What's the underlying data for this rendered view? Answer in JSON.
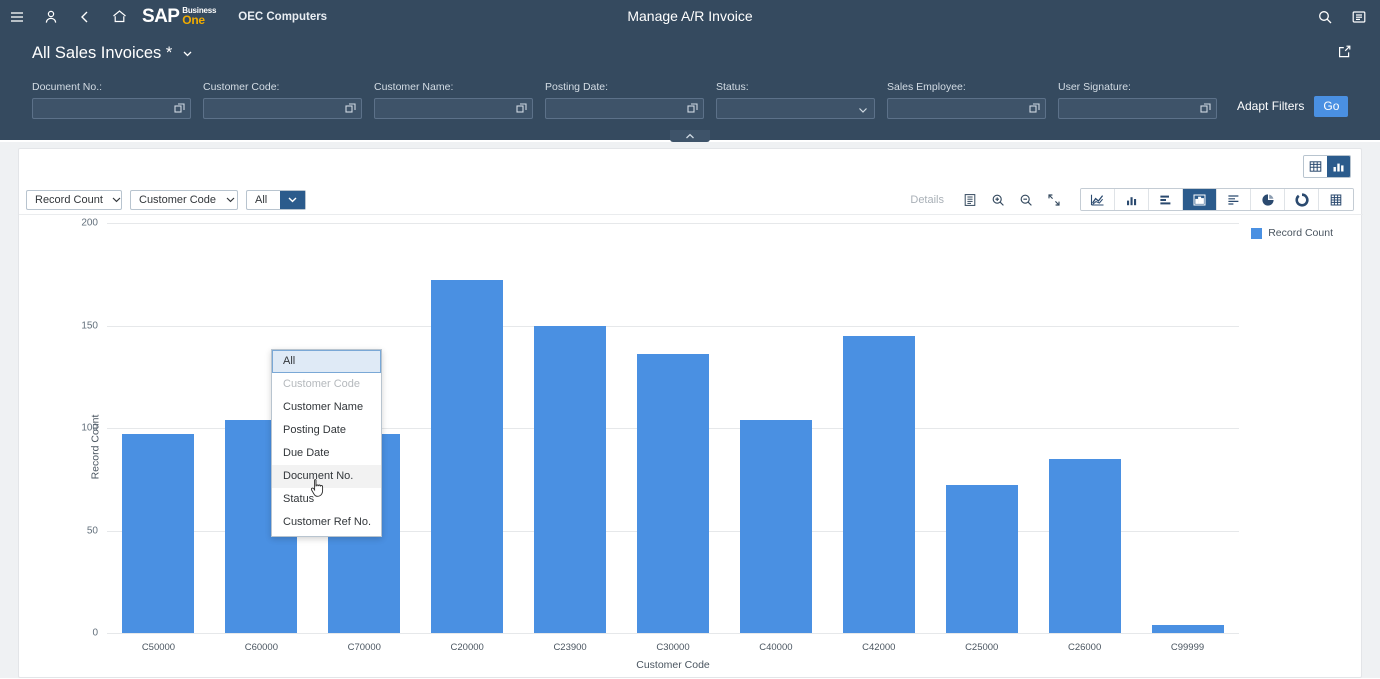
{
  "shell": {
    "title": "Manage A/R Invoice",
    "tenant": "OEC Computers",
    "logo_main": "SAP",
    "logo_sub_top": "Business",
    "logo_sub_bottom": "One",
    "icons": {
      "menu": "menu-icon",
      "user": "user-icon",
      "back": "back-icon",
      "home": "home-icon",
      "search": "search-icon",
      "overflow": "overflow-menu-icon"
    }
  },
  "variant": {
    "title": "All Sales Invoices *",
    "share_icon": "share-icon"
  },
  "filters": {
    "fields": [
      {
        "label": "Document No.:",
        "value": "",
        "type": "valuehelp"
      },
      {
        "label": "Customer Code:",
        "value": "",
        "type": "valuehelp"
      },
      {
        "label": "Customer Name:",
        "value": "",
        "type": "valuehelp"
      },
      {
        "label": "Posting Date:",
        "value": "",
        "type": "valuehelp"
      },
      {
        "label": "Status:",
        "value": "",
        "type": "select"
      },
      {
        "label": "Sales Employee:",
        "value": "",
        "type": "valuehelp"
      },
      {
        "label": "User Signature:",
        "value": "",
        "type": "valuehelp"
      }
    ],
    "adapt_filters_label": "Adapt Filters",
    "go_label": "Go"
  },
  "view_toggle": {
    "table_label": "table-view",
    "chart_label": "chart-view",
    "active": "chart"
  },
  "chart_toolbar": {
    "measure_dropdown": {
      "value": "Record Count"
    },
    "dimension_dropdown": {
      "value": "Customer Code"
    },
    "drill_dropdown": {
      "value": "All",
      "open": true
    },
    "details_label": "Details",
    "icons": [
      "legend-list-icon",
      "zoom-in-icon",
      "zoom-out-icon",
      "fullscreen-icon"
    ],
    "chart_types": [
      {
        "name": "line-chart-icon",
        "active": false
      },
      {
        "name": "column-chart-icon",
        "active": false
      },
      {
        "name": "bar-chart-icon",
        "active": false
      },
      {
        "name": "combined-column-chart-icon",
        "active": true
      },
      {
        "name": "stacked-bar-chart-icon",
        "active": false
      },
      {
        "name": "pie-chart-icon",
        "active": false
      },
      {
        "name": "donut-chart-icon",
        "active": false
      },
      {
        "name": "heatmap-chart-icon",
        "active": false
      }
    ]
  },
  "dropdown_menu": {
    "items": [
      {
        "label": "All",
        "state": "selected"
      },
      {
        "label": "Customer Code",
        "state": "disabled"
      },
      {
        "label": "Customer Name",
        "state": "normal"
      },
      {
        "label": "Posting Date",
        "state": "normal"
      },
      {
        "label": "Due Date",
        "state": "normal"
      },
      {
        "label": "Document No.",
        "state": "hovered"
      },
      {
        "label": "Status",
        "state": "normal"
      },
      {
        "label": "Customer Ref No.",
        "state": "normal"
      }
    ]
  },
  "chart_data": {
    "type": "bar",
    "title": "",
    "xlabel": "Customer Code",
    "ylabel": "Record Count",
    "categories": [
      "C50000",
      "C60000",
      "C70000",
      "C20000",
      "C23900",
      "C30000",
      "C40000",
      "C42000",
      "C25000",
      "C26000",
      "C99999"
    ],
    "values": [
      97,
      104,
      97,
      172,
      150,
      136,
      104,
      145,
      72,
      85,
      4
    ],
    "series": [
      {
        "name": "Record Count",
        "values": [
          97,
          104,
          97,
          172,
          150,
          136,
          104,
          145,
          72,
          85,
          4
        ]
      }
    ],
    "ylim": [
      0,
      200
    ],
    "yticks": [
      0,
      50,
      100,
      150,
      200
    ],
    "grid": true,
    "legend": {
      "position": "top-right",
      "entries": [
        "Record Count"
      ]
    },
    "bar_color": "#4a90e2"
  },
  "colors": {
    "header_bg": "#354a5f",
    "accent": "#4a90e2",
    "active_blue": "#2b5b8c",
    "brand_orange": "#f0ab00"
  }
}
